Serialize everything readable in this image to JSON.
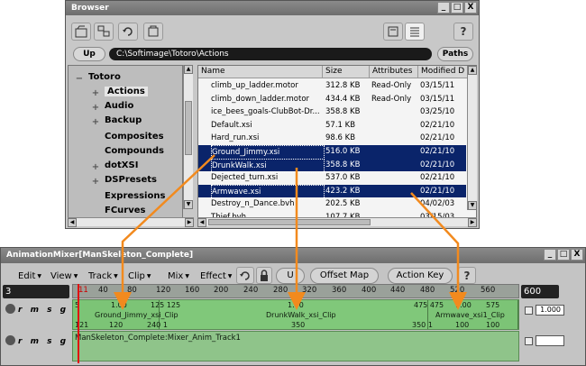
{
  "browser": {
    "title": "Browser",
    "window_buttons": [
      "_",
      "□",
      "X"
    ],
    "up_label": "Up",
    "path": "C:\\Softimage\\Totoro\\Actions",
    "paths_label": "Paths",
    "help_label": "?",
    "tree": {
      "root": "Totoro",
      "items": [
        {
          "label": "Actions",
          "expander": "+",
          "selected": true
        },
        {
          "label": "Audio",
          "expander": "+",
          "selected": false
        },
        {
          "label": "Backup",
          "expander": "+",
          "selected": false
        },
        {
          "label": "Composites",
          "expander": "",
          "selected": false
        },
        {
          "label": "Compounds",
          "expander": "",
          "selected": false
        },
        {
          "label": "dotXSI",
          "expander": "+",
          "selected": false
        },
        {
          "label": "DSPresets",
          "expander": "+",
          "selected": false
        },
        {
          "label": "Expressions",
          "expander": "",
          "selected": false
        },
        {
          "label": "FCurves",
          "expander": "",
          "selected": false
        }
      ]
    },
    "columns": [
      "Name",
      "Size",
      "Attributes",
      "Modified D"
    ],
    "files": [
      {
        "name": "climb_up_ladder.motor",
        "size": "312.8 KB",
        "attr": "Read-Only",
        "modified": "03/15/11",
        "highlight": false
      },
      {
        "name": "climb_down_ladder.motor",
        "size": "434.4 KB",
        "attr": "Read-Only",
        "modified": "03/15/11",
        "highlight": false
      },
      {
        "name": "ice_bees_goals-ClubBot-Dr...",
        "size": "358.8 KB",
        "attr": "",
        "modified": "03/25/10",
        "highlight": false
      },
      {
        "name": "Default.xsi",
        "size": "57.1 KB",
        "attr": "",
        "modified": "02/21/10",
        "highlight": false
      },
      {
        "name": "Hard_run.xsi",
        "size": "98.6 KB",
        "attr": "",
        "modified": "02/21/10",
        "highlight": false
      },
      {
        "name": "Ground_Jimmy.xsi",
        "size": "516.0 KB",
        "attr": "",
        "modified": "02/21/10",
        "highlight": true
      },
      {
        "name": "DrunkWalk.xsi",
        "size": "358.8 KB",
        "attr": "",
        "modified": "02/21/10",
        "highlight": true
      },
      {
        "name": "Dejected_turn.xsi",
        "size": "537.0 KB",
        "attr": "",
        "modified": "02/21/10",
        "highlight": false
      },
      {
        "name": "Armwave.xsi",
        "size": "423.2 KB",
        "attr": "",
        "modified": "02/21/10",
        "highlight": true
      },
      {
        "name": "Destroy_n_Dance.bvh",
        "size": "202.5 KB",
        "attr": "",
        "modified": "04/02/03",
        "highlight": false
      },
      {
        "name": "Thief.bvh",
        "size": "107.7 KB",
        "attr": "",
        "modified": "03/15/03",
        "highlight": false
      }
    ]
  },
  "mixer": {
    "title": "AnimationMixer[ManSkeleton_Complete]",
    "window_buttons": [
      "_",
      "□",
      "X"
    ],
    "menus": [
      "Edit",
      "View",
      "Track",
      "Clip",
      "Mix",
      "Effect"
    ],
    "undo_label": "U",
    "offset_map_label": "Offset Map",
    "action_key_label": "Action Key",
    "help_label": "?",
    "start_frame": "3",
    "end_frame": "600",
    "ruler_ticks": [
      "11",
      "40",
      "80",
      "120",
      "160",
      "200",
      "240",
      "280",
      "320",
      "360",
      "400",
      "440",
      "480",
      "520",
      "560"
    ],
    "track1": {
      "controls": "r m s g",
      "weight": "1.000",
      "clips": [
        {
          "name": "Ground_Jimmy_xsi_Clip",
          "top_marks": [
            "5",
            "1.00",
            "125 125"
          ],
          "bottom_marks": [
            "121",
            "120",
            "240 1"
          ]
        },
        {
          "name": "DrunkWalk_xsi_Clip",
          "top_marks": [
            "1.00",
            "475 475"
          ],
          "bottom_marks": [
            "350",
            "350 1"
          ]
        },
        {
          "name": "Armwave_xsi1_Clip",
          "top_marks": [
            "1.00",
            "575"
          ],
          "bottom_marks": [
            "100",
            "100"
          ]
        }
      ]
    },
    "track2": {
      "controls": "r m s g",
      "label": "ManSkeleton_Complete:Mixer_Anim_Track1"
    }
  },
  "colors": {
    "selection": "#0a246a",
    "track_green": "#73b86d",
    "arrow_orange": "#f28a1e",
    "cursor_red": "#e01010"
  }
}
